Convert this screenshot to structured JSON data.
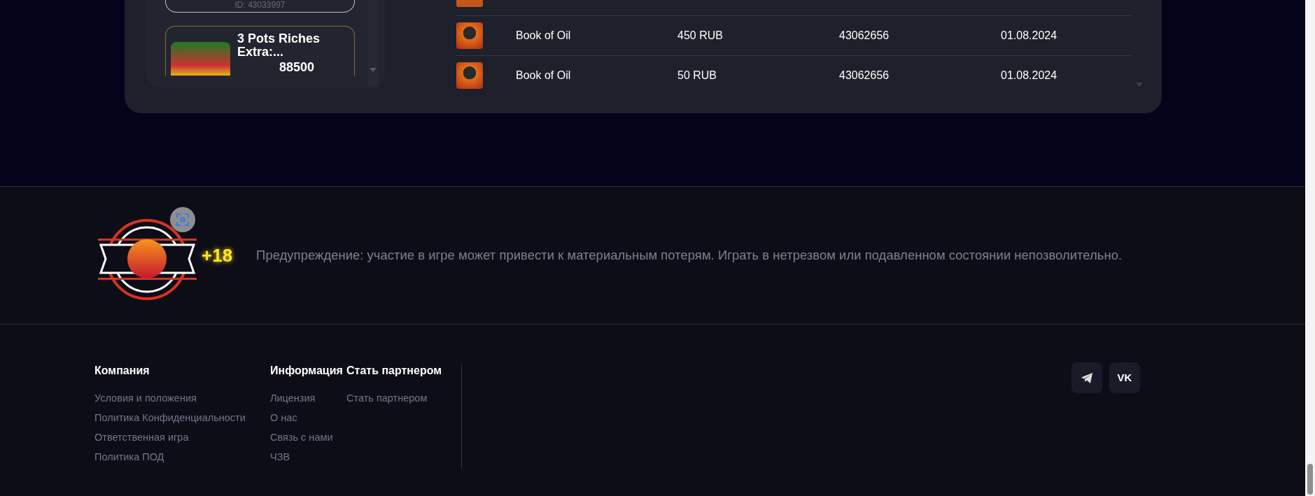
{
  "top_panel": {
    "player_card": {
      "id_text": "ID: 43033997"
    },
    "game_card": {
      "title": "3 Pots Riches Extra:...",
      "amount": "88500"
    },
    "table": {
      "rows": [
        {
          "game": "Book of Oil",
          "amount": "450 RUB",
          "player_id": "43062656",
          "date": "01.08.2024"
        },
        {
          "game": "Book of Oil",
          "amount": "50 RUB",
          "player_id": "43062656",
          "date": "01.08.2024"
        }
      ]
    }
  },
  "footer": {
    "age_badge": "+18",
    "warning": "Предупреждение: участие в игре может привести к материальным потерям. Играть в нетрезвом или подавленном состоянии непозволительно.",
    "columns": [
      {
        "title": "Компания",
        "links": [
          "Условия и положения",
          "Политика Конфиденциальности",
          "Ответственная игра",
          "Политика ПОД"
        ]
      },
      {
        "title": "Информация",
        "links": [
          "Лицензия",
          "О нас",
          "Связь с нами",
          "ЧЗВ"
        ]
      },
      {
        "title": "Стать партнером",
        "links": [
          "Стать партнером"
        ]
      }
    ],
    "social": [
      {
        "kind": "telegram"
      },
      {
        "kind": "vk",
        "label": "VK"
      }
    ]
  }
}
